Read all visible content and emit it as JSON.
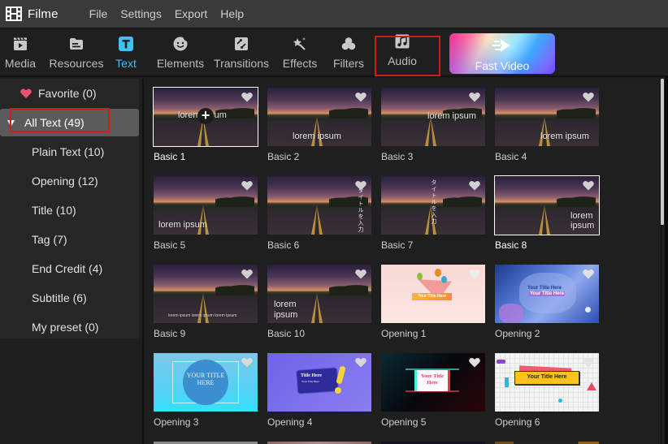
{
  "app": {
    "name": "Filme",
    "menu": [
      "File",
      "Settings",
      "Export",
      "Help"
    ]
  },
  "toolbar": {
    "tools": [
      {
        "label": "Media",
        "icon": "media-clapper-icon",
        "active": false
      },
      {
        "label": "Resources",
        "icon": "folder-icon",
        "active": false
      },
      {
        "label": "Text",
        "icon": "text-t-icon",
        "active": true
      },
      {
        "label": "Elements",
        "icon": "smiley-sticker-icon",
        "active": false
      },
      {
        "label": "Transitions",
        "icon": "transition-arrows-icon",
        "active": false
      },
      {
        "label": "Effects",
        "icon": "magic-wand-icon",
        "active": false
      },
      {
        "label": "Filters",
        "icon": "filters-circles-icon",
        "active": false
      },
      {
        "label": "Audio",
        "icon": "music-note-icon",
        "active": false,
        "highlighted": true
      }
    ],
    "fast_video": {
      "label": "Fast Video",
      "icon": "fast-forward-arrow-icon"
    },
    "active_color": "#3ec1f3",
    "highlight_color": "#d41b1b"
  },
  "sidebar": {
    "favorite": {
      "label": "Favorite (0)",
      "icon": "heart-icon",
      "icon_color": "#f0506e"
    },
    "all_text": {
      "label": "All Text (49)",
      "expanded": true,
      "highlighted": true
    },
    "categories": [
      {
        "label": "Plain Text (10)"
      },
      {
        "label": "Opening (12)"
      },
      {
        "label": "Title (10)"
      },
      {
        "label": "Tag (7)"
      },
      {
        "label": "End Credit (4)"
      },
      {
        "label": "Subtitle (6)"
      },
      {
        "label": "My preset (0)"
      }
    ]
  },
  "grid": {
    "items": [
      {
        "label": "Basic 1",
        "preview_text": "lorem ipsum",
        "selected": true,
        "hover_add": true
      },
      {
        "label": "Basic 2",
        "preview_text": "lorem ipsum"
      },
      {
        "label": "Basic 3",
        "preview_text": "lorem ipsum"
      },
      {
        "label": "Basic 4",
        "preview_text": "lorem ipsum"
      },
      {
        "label": "Basic 5",
        "preview_text": "lorem ipsum"
      },
      {
        "label": "Basic 6",
        "preview_text": "タイトルを入力"
      },
      {
        "label": "Basic 7",
        "preview_text": "タイトルを入力"
      },
      {
        "label": "Basic 8",
        "preview_text": "lorem ipsum",
        "selected": true
      },
      {
        "label": "Basic 9",
        "preview_text": "lorem ipsum lorem ipsum lorem ipsum"
      },
      {
        "label": "Basic 10",
        "preview_text": "lorem ipsum"
      },
      {
        "label": "Opening 1",
        "preview_text": "Your Title Here"
      },
      {
        "label": "Opening 2",
        "preview_text": "Your Title Here"
      },
      {
        "label": "Opening 3",
        "preview_text": "YOUR TITLE HERE"
      },
      {
        "label": "Opening 4",
        "preview_text": "Title Here",
        "preview_subtext": "Your Title Here"
      },
      {
        "label": "Opening 5",
        "preview_text": "Your Title Here"
      },
      {
        "label": "Opening 6",
        "preview_text": "Your Title Here"
      }
    ]
  },
  "scrollbar": {
    "position_fraction": 0.0,
    "visible_fraction": 0.4
  }
}
